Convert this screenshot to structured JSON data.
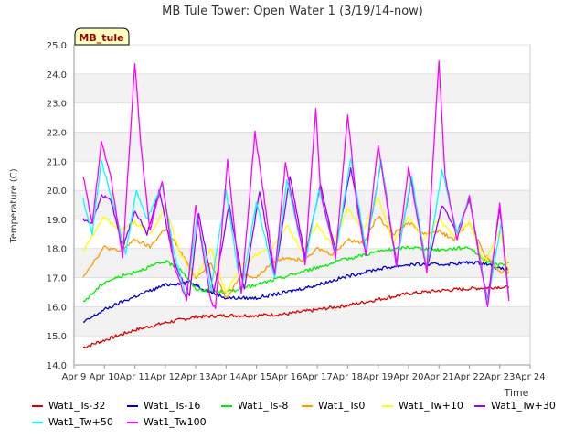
{
  "chart_data": {
    "type": "line",
    "title": "MB Tule Tower: Open Water 1 (3/19/14-now)",
    "xlabel": "Time",
    "ylabel": "Temperature (C)",
    "site_label": "MB_tule",
    "xlim": [
      0,
      15
    ],
    "ylim": [
      14.0,
      25.0
    ],
    "x_ticks": [
      {
        "x": 0,
        "label": "Apr 9"
      },
      {
        "x": 1,
        "label": "Apr 10"
      },
      {
        "x": 2,
        "label": "Apr 11"
      },
      {
        "x": 3,
        "label": "Apr 12"
      },
      {
        "x": 4,
        "label": "Apr 13"
      },
      {
        "x": 5,
        "label": "Apr 14"
      },
      {
        "x": 6,
        "label": "Apr 15"
      },
      {
        "x": 7,
        "label": "Apr 16"
      },
      {
        "x": 8,
        "label": "Apr 17"
      },
      {
        "x": 9,
        "label": "Apr 18"
      },
      {
        "x": 10,
        "label": "Apr 19"
      },
      {
        "x": 11,
        "label": "Apr 20"
      },
      {
        "x": 12,
        "label": "Apr 21"
      },
      {
        "x": 13,
        "label": "Apr 22"
      },
      {
        "x": 14,
        "label": "Apr 23"
      },
      {
        "x": 15,
        "label": "Apr 24"
      }
    ],
    "y_ticks": [
      14.0,
      15.0,
      16.0,
      17.0,
      18.0,
      19.0,
      20.0,
      21.0,
      22.0,
      23.0,
      24.0,
      25.0
    ],
    "series": [
      {
        "name": "Wat1_Ts-32",
        "color": "#dd0000",
        "points": [
          [
            0.3,
            14.6
          ],
          [
            1,
            14.85
          ],
          [
            2,
            15.2
          ],
          [
            3,
            15.45
          ],
          [
            4,
            15.65
          ],
          [
            5,
            15.7
          ],
          [
            6,
            15.7
          ],
          [
            7,
            15.75
          ],
          [
            8,
            15.9
          ],
          [
            9,
            16.05
          ],
          [
            10,
            16.25
          ],
          [
            11,
            16.45
          ],
          [
            12,
            16.55
          ],
          [
            13,
            16.62
          ],
          [
            14,
            16.68
          ],
          [
            14.3,
            16.65
          ]
        ]
      },
      {
        "name": "Wat1_Ts-16",
        "color": "#0000cc",
        "points": [
          [
            0.3,
            15.45
          ],
          [
            1,
            15.9
          ],
          [
            2,
            16.35
          ],
          [
            3,
            16.75
          ],
          [
            3.8,
            16.85
          ],
          [
            4.5,
            16.5
          ],
          [
            5,
            16.3
          ],
          [
            6,
            16.3
          ],
          [
            7,
            16.5
          ],
          [
            8,
            16.75
          ],
          [
            9,
            17.05
          ],
          [
            10,
            17.3
          ],
          [
            11,
            17.45
          ],
          [
            12,
            17.45
          ],
          [
            13,
            17.52
          ],
          [
            13.5,
            17.5
          ],
          [
            14,
            17.3
          ],
          [
            14.3,
            17.3
          ]
        ]
      },
      {
        "name": "Wat1_Ts-8",
        "color": "#00ee00",
        "points": [
          [
            0.3,
            16.15
          ],
          [
            1,
            16.85
          ],
          [
            2,
            17.2
          ],
          [
            3,
            17.55
          ],
          [
            3.5,
            17.3
          ],
          [
            4,
            16.6
          ],
          [
            5,
            16.5
          ],
          [
            6,
            16.75
          ],
          [
            7,
            17.05
          ],
          [
            8,
            17.35
          ],
          [
            9,
            17.65
          ],
          [
            10,
            17.9
          ],
          [
            11,
            18.05
          ],
          [
            12,
            17.95
          ],
          [
            13,
            18.05
          ],
          [
            13.5,
            17.6
          ],
          [
            14,
            17.45
          ],
          [
            14.3,
            17.5
          ]
        ]
      },
      {
        "name": "Wat1_Ts0",
        "color": "#ff9900",
        "points": [
          [
            0.3,
            17.05
          ],
          [
            1,
            18.05
          ],
          [
            1.5,
            17.9
          ],
          [
            2,
            18.3
          ],
          [
            2.5,
            18.05
          ],
          [
            3,
            18.7
          ],
          [
            3.5,
            17.9
          ],
          [
            4,
            17.0
          ],
          [
            4.5,
            17.5
          ],
          [
            5,
            16.3
          ],
          [
            5.5,
            17.1
          ],
          [
            6,
            17.0
          ],
          [
            6.5,
            17.5
          ],
          [
            7,
            17.7
          ],
          [
            7.5,
            17.6
          ],
          [
            8,
            18.0
          ],
          [
            8.5,
            17.8
          ],
          [
            9,
            18.3
          ],
          [
            9.5,
            18.2
          ],
          [
            10,
            19.1
          ],
          [
            10.5,
            18.5
          ],
          [
            11,
            18.9
          ],
          [
            11.5,
            18.5
          ],
          [
            12,
            18.6
          ],
          [
            12.5,
            18.3
          ],
          [
            13,
            18.9
          ],
          [
            13.5,
            17.8
          ],
          [
            14,
            17.2
          ],
          [
            14.3,
            17.2
          ]
        ]
      },
      {
        "name": "Wat1_Tw+10",
        "color": "#ffff00",
        "points": [
          [
            0.3,
            17.9
          ],
          [
            1,
            19.1
          ],
          [
            1.5,
            18.6
          ],
          [
            2,
            18.9
          ],
          [
            2.5,
            18.5
          ],
          [
            3,
            19.4
          ],
          [
            3.5,
            17.8
          ],
          [
            4,
            17.0
          ],
          [
            4.5,
            18.0
          ],
          [
            5,
            16.5
          ],
          [
            5.5,
            17.4
          ],
          [
            6,
            17.8
          ],
          [
            6.5,
            18.0
          ],
          [
            7,
            18.8
          ],
          [
            7.5,
            17.9
          ],
          [
            8,
            18.8
          ],
          [
            8.5,
            18.1
          ],
          [
            9,
            19.4
          ],
          [
            9.5,
            18.6
          ],
          [
            10,
            19.8
          ],
          [
            10.5,
            18.2
          ],
          [
            11,
            19.1
          ],
          [
            11.5,
            18.3
          ],
          [
            12,
            19.0
          ],
          [
            12.5,
            18.4
          ],
          [
            13,
            18.9
          ],
          [
            13.5,
            17.5
          ],
          [
            14,
            18.6
          ],
          [
            14.3,
            17.2
          ]
        ]
      },
      {
        "name": "Wat1_Tw+30",
        "color": "#9900ff",
        "points": [
          [
            0.3,
            19.0
          ],
          [
            0.6,
            18.9
          ],
          [
            0.9,
            19.8
          ],
          [
            1.2,
            19.7
          ],
          [
            1.6,
            18.0
          ],
          [
            2,
            19.3
          ],
          [
            2.4,
            18.5
          ],
          [
            2.8,
            20.0
          ],
          [
            3.3,
            17.5
          ],
          [
            3.8,
            16.4
          ],
          [
            4.1,
            19.2
          ],
          [
            4.6,
            16.5
          ],
          [
            5.1,
            19.5
          ],
          [
            5.6,
            16.6
          ],
          [
            6.1,
            20.0
          ],
          [
            6.6,
            17.0
          ],
          [
            7.1,
            20.5
          ],
          [
            7.6,
            17.7
          ],
          [
            8.1,
            20.2
          ],
          [
            8.6,
            17.9
          ],
          [
            9.1,
            20.8
          ],
          [
            9.6,
            17.9
          ],
          [
            10.1,
            21.0
          ],
          [
            10.6,
            17.5
          ],
          [
            11.1,
            20.4
          ],
          [
            11.6,
            17.3
          ],
          [
            12.1,
            19.5
          ],
          [
            12.6,
            18.6
          ],
          [
            13.0,
            19.7
          ],
          [
            13.6,
            16.2
          ],
          [
            14.0,
            19.4
          ],
          [
            14.3,
            16.3
          ]
        ]
      },
      {
        "name": "Wat1_Tw+50",
        "color": "#00ffff",
        "points": [
          [
            0.3,
            19.7
          ],
          [
            0.6,
            18.5
          ],
          [
            0.9,
            21.0
          ],
          [
            1.3,
            19.5
          ],
          [
            1.7,
            17.8
          ],
          [
            2.05,
            20.0
          ],
          [
            2.4,
            19.0
          ],
          [
            2.9,
            20.2
          ],
          [
            3.3,
            17.8
          ],
          [
            3.7,
            16.3
          ],
          [
            4.05,
            19.2
          ],
          [
            4.5,
            16.6
          ],
          [
            5.0,
            20.0
          ],
          [
            5.5,
            16.5
          ],
          [
            6.0,
            19.6
          ],
          [
            6.6,
            17.0
          ],
          [
            7.0,
            20.4
          ],
          [
            7.6,
            17.5
          ],
          [
            8.05,
            20.0
          ],
          [
            8.6,
            17.8
          ],
          [
            9.1,
            21.1
          ],
          [
            9.6,
            18.0
          ],
          [
            10.1,
            21.0
          ],
          [
            10.6,
            17.4
          ],
          [
            11.1,
            20.5
          ],
          [
            11.6,
            17.3
          ],
          [
            12.1,
            20.7
          ],
          [
            12.6,
            18.5
          ],
          [
            13.0,
            19.8
          ],
          [
            13.6,
            16.1
          ],
          [
            14.05,
            18.9
          ],
          [
            14.3,
            16.3
          ]
        ]
      },
      {
        "name": "Wat1_Tw100",
        "color": "#ff00ff",
        "points": [
          [
            0.3,
            20.5
          ],
          [
            0.6,
            18.8
          ],
          [
            0.9,
            21.7
          ],
          [
            1.2,
            20.5
          ],
          [
            1.6,
            17.7
          ],
          [
            2.0,
            24.4
          ],
          [
            2.2,
            21.5
          ],
          [
            2.5,
            18.6
          ],
          [
            2.9,
            20.3
          ],
          [
            3.3,
            17.4
          ],
          [
            3.7,
            16.2
          ],
          [
            4.0,
            19.5
          ],
          [
            4.5,
            16.2
          ],
          [
            4.65,
            15.95
          ],
          [
            5.05,
            21.0
          ],
          [
            5.5,
            16.4
          ],
          [
            5.95,
            22.0
          ],
          [
            6.6,
            17.1
          ],
          [
            6.95,
            20.9
          ],
          [
            7.6,
            17.5
          ],
          [
            7.95,
            22.8
          ],
          [
            8.1,
            20.0
          ],
          [
            8.6,
            17.7
          ],
          [
            9.0,
            22.6
          ],
          [
            9.3,
            19.5
          ],
          [
            9.6,
            17.7
          ],
          [
            10.0,
            21.6
          ],
          [
            10.6,
            17.4
          ],
          [
            11.0,
            20.8
          ],
          [
            11.6,
            17.2
          ],
          [
            12.0,
            24.5
          ],
          [
            12.2,
            20.5
          ],
          [
            12.6,
            18.3
          ],
          [
            13.0,
            19.8
          ],
          [
            13.6,
            16.0
          ],
          [
            14.0,
            19.6
          ],
          [
            14.3,
            16.2
          ]
        ]
      }
    ],
    "legend": {
      "placement": "bottom"
    }
  }
}
